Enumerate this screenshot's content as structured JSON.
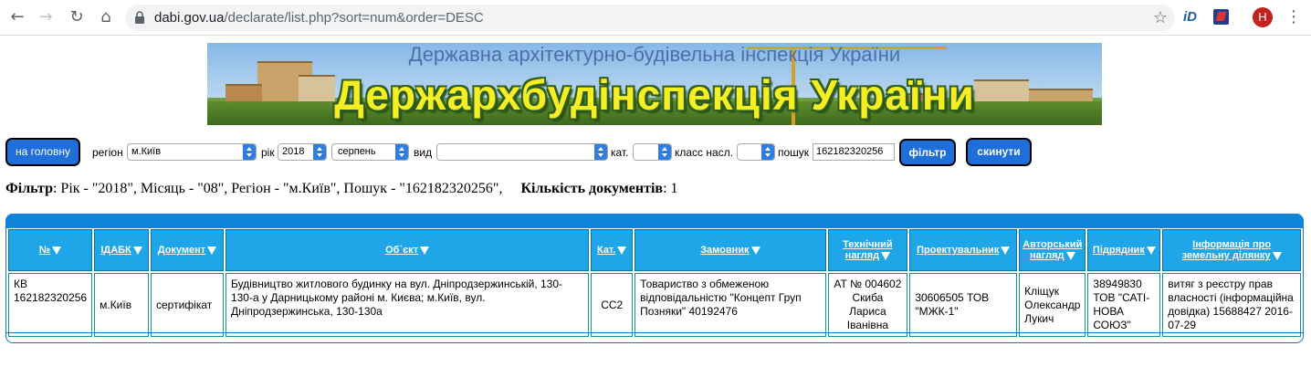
{
  "browser": {
    "url_host": "dabi.gov.ua",
    "url_path": "/declarate/list.php?sort=num&order=DESC",
    "ext_label": "iD",
    "avatar_letter": "H"
  },
  "banner": {
    "subtitle": "Державна архітектурно-будівельна інспекція України",
    "title": "Держархбудінспекція України"
  },
  "filters": {
    "home_button": "на головну",
    "region_label": "регіон",
    "region_value": "м.Київ",
    "year_label": "рік",
    "year_value": "2018",
    "month_value": "серпень",
    "type_label": "вид",
    "type_value": "",
    "category_label": "кат.",
    "category_value": "",
    "class_label": "класс насл.",
    "class_value": "",
    "search_label": "пошук",
    "search_value": "162182320256",
    "filter_button": "фільтр",
    "reset_button": "скинути"
  },
  "summary": {
    "filter_label": "Фільтр",
    "filter_text": ": Рік - \"2018\", Місяць - \"08\", Регіон - \"м.Київ\", Пошук - \"162182320256\",",
    "count_label": "Кількість документів",
    "count_value": ": 1"
  },
  "table": {
    "headers": [
      {
        "line1": "№",
        "line2": ""
      },
      {
        "line1": "ІДАБК",
        "line2": ""
      },
      {
        "line1": "Документ",
        "line2": ""
      },
      {
        "line1": "Об`єкт",
        "line2": ""
      },
      {
        "line1": "Кат.",
        "line2": ""
      },
      {
        "line1": "Замовник",
        "line2": ""
      },
      {
        "line1": "Технічний",
        "line2": "нагляд"
      },
      {
        "line1": "Проектувальник",
        "line2": ""
      },
      {
        "line1": "Авторський",
        "line2": "нагляд"
      },
      {
        "line1": "Підрядник",
        "line2": ""
      },
      {
        "line1": "Інформація про",
        "line2": "земельну ділянку"
      }
    ],
    "rows": [
      {
        "num": "КВ 162182320256",
        "idabk": "м.Київ",
        "document": "сертифікат",
        "object": "Будівництво житлового будинку на вул. Дніпродзержинській, 130-130-а у Дарницькому районі м. Києва; м.Київ, вул. Дніпродзержинська, 130-130а",
        "category": "СС2",
        "customer": "Товариство з обмеженою відповідальністю \"Концепт Груп Позняки\" 40192476",
        "tech_supervision": "АТ № 004602 Скиба Лариса Іванівна",
        "designer": "30606505 ТОВ \"МЖК-1\"",
        "author_supervision": "Кліщук Олександр Лукич",
        "contractor": "38949830 ТОВ \"САТІ-НОВА СОЮЗ\"",
        "land_info": "витяг з реєстру прав власності (інформаційна довідка) 15688427 2016-07-29"
      }
    ]
  }
}
